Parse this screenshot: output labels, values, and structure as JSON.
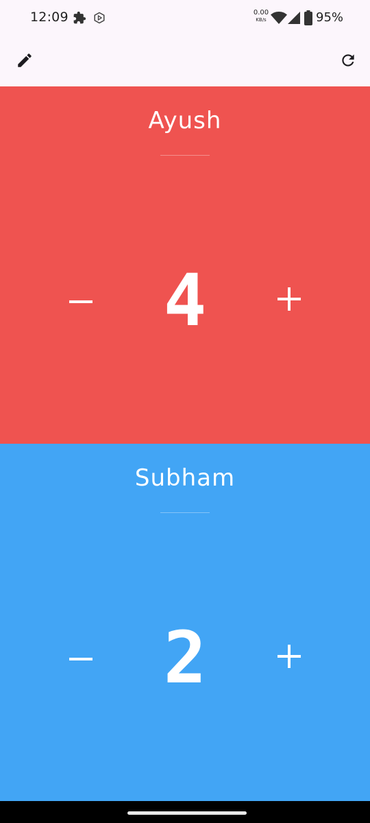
{
  "status_bar": {
    "time": "12:09",
    "net_speed_value": "0.00",
    "net_speed_unit": "KB/s",
    "battery": "95%",
    "icons": [
      "puzzle-icon",
      "notification-app-icon",
      "wifi-icon",
      "cellular-signal-icon",
      "battery-icon"
    ]
  },
  "app_bar": {
    "left_icon": "edit-pencil-icon",
    "right_icon": "refresh-icon"
  },
  "players": [
    {
      "name": "Ayush",
      "score": "4",
      "color": "#ef5350",
      "minus_label": "−",
      "plus_label": "+"
    },
    {
      "name": "Subham",
      "score": "2",
      "color": "#42a5f5",
      "minus_label": "−",
      "plus_label": "+"
    }
  ],
  "colors": {
    "app_bar_bg": "#fcf6fc",
    "text_on_panel": "#ffffff"
  }
}
